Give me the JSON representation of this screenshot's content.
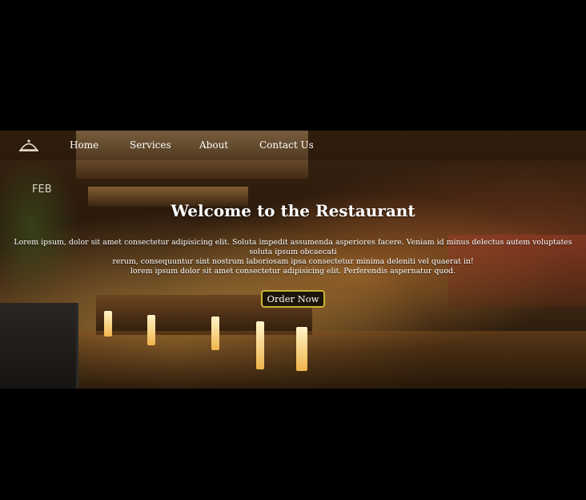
{
  "nav": {
    "logo_icon": "restaurant-cloche-icon",
    "items": [
      {
        "label": "Home"
      },
      {
        "label": "Services"
      },
      {
        "label": "About"
      },
      {
        "label": "Contact Us"
      }
    ]
  },
  "hero": {
    "title": "Welcome to the Restaurant",
    "description_line1": "Lorem ipsum, dolor sit amet consectetur adipisicing elit. Soluta impedit assumenda asperiores facere. Veniam id minus delectus autem voluptates soluta ipsum obcaecati",
    "description_line2": "rerum, consequuntur sint nostrum laboriosam ipsa consectetur minima deleniti vel quaerat in!",
    "description_line3": "lorem ipsum dolor sit amet consectetur adipisicing elit. Perferendis aspernatur quod.",
    "cta_label": "Order Now",
    "chalkboard_text": "FEB"
  },
  "colors": {
    "background": "#000000",
    "cta_border": "#c9b336",
    "cta_fill": "#1c1406",
    "text": "#ffffff"
  }
}
